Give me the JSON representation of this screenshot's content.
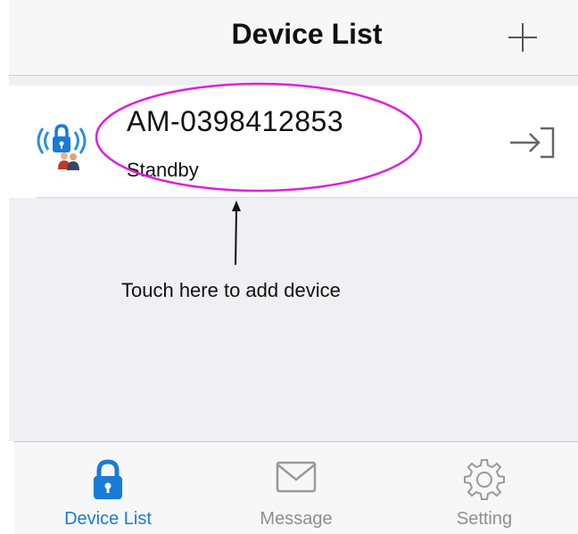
{
  "header": {
    "title": "Device List",
    "add_icon": "plus-icon"
  },
  "devices": [
    {
      "name": "AM-0398412853",
      "status": "Standby",
      "icon": "lock-signal-users-icon",
      "action_icon": "enter-arrow-icon"
    }
  ],
  "annotation": {
    "hint": "Touch here to add device",
    "ellipse_color": "#e01ee0"
  },
  "tabbar": {
    "tabs": [
      {
        "label": "Device List",
        "icon": "lock-icon",
        "active": true
      },
      {
        "label": "Message",
        "icon": "envelope-icon",
        "active": false
      },
      {
        "label": "Setting",
        "icon": "gear-icon",
        "active": false
      }
    ]
  },
  "colors": {
    "accent": "#1a7ad8",
    "inactive": "#8e8e93"
  }
}
